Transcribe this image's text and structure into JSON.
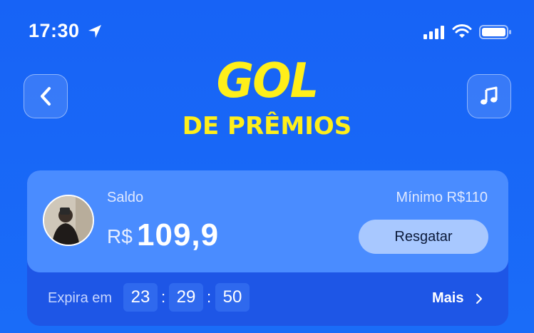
{
  "status_bar": {
    "time": "17:30"
  },
  "header": {
    "logo_line1": "GOL",
    "logo_line2": "DE PRÊMIOS",
    "back_icon": "chevron-left-icon",
    "music_icon": "music-note-icon"
  },
  "balance_card": {
    "label": "Saldo",
    "currency": "R$",
    "amount": "109,9",
    "minimum_label": "Mínimo  R$110",
    "redeem_button": "Resgatar",
    "expires_label": "Expira em",
    "timer": {
      "hours": "23",
      "minutes": "29",
      "seconds": "50"
    },
    "more_link": "Mais"
  },
  "colors": {
    "background": "#1763f6",
    "card_dark": "#1e56e6",
    "card_light": "#4a8cff",
    "button": "#a8c8ff",
    "logo_yellow": "#ffef1a"
  }
}
